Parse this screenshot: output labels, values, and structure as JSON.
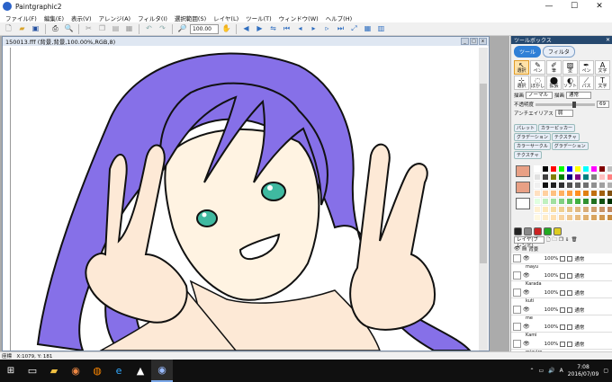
{
  "window": {
    "title": "Paintgraphic2",
    "minimize": "—",
    "maximize": "☐",
    "close": "✕"
  },
  "menu": [
    "ファイル(F)",
    "編集(E)",
    "表示(V)",
    "アレンジ(A)",
    "フィルタ(I)",
    "選択範囲(S)",
    "レイヤ(L)",
    "ツール(T)",
    "ウィンドウ(W)",
    "ヘルプ(H)"
  ],
  "toolbar": {
    "zoom": "100.00",
    "icons": [
      "new-icon",
      "open-icon",
      "save-icon",
      "print-icon",
      "print-preview-icon",
      "cut-icon",
      "copy-icon",
      "paste-icon",
      "paste-new-icon",
      "undo-icon",
      "redo-icon",
      "zoom-icon",
      "hand-icon"
    ],
    "nav_icons": [
      "rotate-left-icon",
      "rotate-right-icon",
      "flip-icon",
      "first-icon",
      "prev-icon",
      "play-icon",
      "next-icon",
      "last-icon",
      "resize-icon",
      "grid-icon",
      "rulers-icon"
    ]
  },
  "document": {
    "title": "150013.fff (背景,背景,100.00%,RGB,8)"
  },
  "toolbox": {
    "title": "ツールボックス",
    "tabs": [
      "ツール",
      "フィルタ"
    ],
    "tools": [
      {
        "glyph": "↖",
        "label": "選択"
      },
      {
        "glyph": "✎",
        "label": "ペン"
      },
      {
        "glyph": "✐",
        "label": "筆"
      },
      {
        "glyph": "▨",
        "label": "塗"
      },
      {
        "glyph": "✒",
        "label": "ペン"
      },
      {
        "glyph": "A",
        "label": "文字"
      },
      {
        "glyph": "⊹",
        "label": "選択"
      },
      {
        "glyph": "◌",
        "label": "ぼかし"
      },
      {
        "glyph": "⬤",
        "label": "拡張"
      },
      {
        "glyph": "◐",
        "label": "ソフト"
      },
      {
        "glyph": "⟋",
        "label": "パス"
      },
      {
        "glyph": "T",
        "label": "文字"
      }
    ],
    "draw_mode_label": "描画",
    "draw_mode": "ノーマル",
    "blend_label": "描画",
    "blend": "通常",
    "opacity_label": "不透明度",
    "opacity_value": "69",
    "antialias_label": "アンチエイリアス",
    "antialias": "弱"
  },
  "color": {
    "tabs": [
      "パレット",
      "カラーピッカー",
      "グラデーション",
      "テクスチャ",
      "カラーサークル",
      "グラデーション",
      "テクスチャ"
    ],
    "main": "#e8a085",
    "palette": [
      "#ffffff",
      "#000000",
      "#ff0000",
      "#00ff00",
      "#0000ff",
      "#ffff00",
      "#00ffff",
      "#ff00ff",
      "#800000",
      "#c0c0c0",
      "#e0e0e0",
      "#404040",
      "#808000",
      "#008000",
      "#000080",
      "#800080",
      "#008080",
      "#808080",
      "#ffc0c0",
      "#ff8080",
      "#f0f0f0",
      "#101010",
      "#202020",
      "#303030",
      "#505050",
      "#606060",
      "#707070",
      "#909090",
      "#a0a0a0",
      "#b0b0b0",
      "#ffe0c0",
      "#ffd0a0",
      "#ffc080",
      "#ffb060",
      "#ffa040",
      "#ff9020",
      "#e08010",
      "#c07010",
      "#a06010",
      "#805010",
      "#e0ffe0",
      "#c0f0c0",
      "#a0e0a0",
      "#80d080",
      "#60c060",
      "#40b040",
      "#309030",
      "#207020",
      "#105010",
      "#003000",
      "#fff0d0",
      "#ffe8b8",
      "#f8dca0",
      "#f0d090",
      "#e8c488",
      "#e0b880",
      "#d8ac78",
      "#d0a070",
      "#c89468",
      "#c08860",
      "#fff8e0",
      "#ffecc8",
      "#ffe0b0",
      "#f8d4a0",
      "#f0c890",
      "#e8bc80",
      "#e0b070",
      "#d8a460",
      "#d09850",
      "#c88c40"
    ]
  },
  "layers": {
    "mode_label": "レイヤ(ブレンド)",
    "mode_icons": [
      "new-layer-icon",
      "layer-folder-icon",
      "duplicate-layer-icon",
      "merge-icon",
      "delete-layer-icon"
    ],
    "group": "背景",
    "items": [
      {
        "name": "mayu",
        "opacity": "100%",
        "mode": "通常"
      },
      {
        "name": "Karada",
        "opacity": "100%",
        "mode": "通常"
      },
      {
        "name": "kuti",
        "opacity": "100%",
        "mode": "通常"
      },
      {
        "name": "me",
        "opacity": "100%",
        "mode": "通常"
      },
      {
        "name": "Kami",
        "opacity": "100%",
        "mode": "通常"
      },
      {
        "name": "mizuiro",
        "opacity": "100%",
        "mode": "通常"
      }
    ]
  },
  "status": {
    "text": "座標　X:1079, Y: 181"
  },
  "taskbar": {
    "time": "7:08",
    "date": "2016/07/09",
    "lang": "A"
  }
}
